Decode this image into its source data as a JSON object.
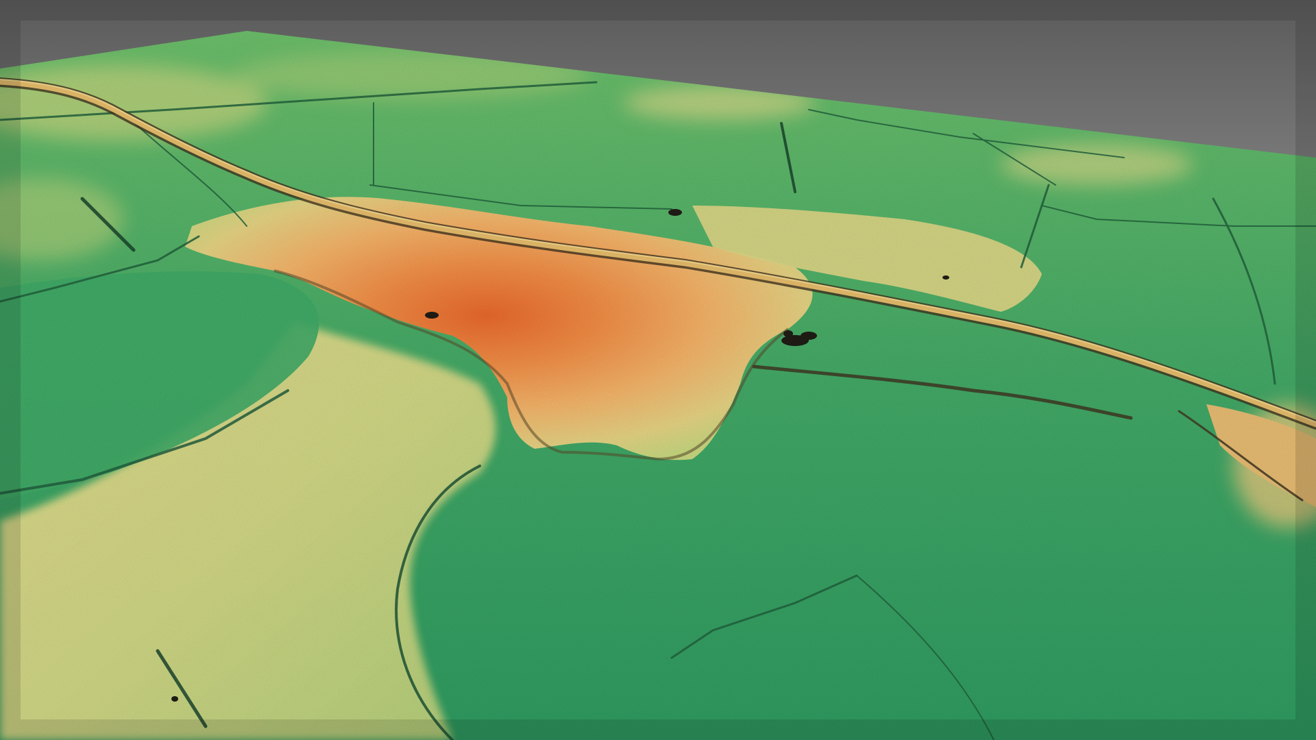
{
  "scene": {
    "kind": "3d-lidar-elevation-render",
    "background_color": "#7f7f7f",
    "elevation_ramp": {
      "low": "#2f9d63",
      "low_mid": "#5cb568",
      "mid": "#b8cf7a",
      "mid_high": "#e6d98a",
      "high": "#f2a25a",
      "peak": "#e8702e"
    },
    "features": [
      "terrain-surface",
      "raised-plateau",
      "road-embankment",
      "field-boundary-ditches",
      "sink-holes"
    ]
  }
}
